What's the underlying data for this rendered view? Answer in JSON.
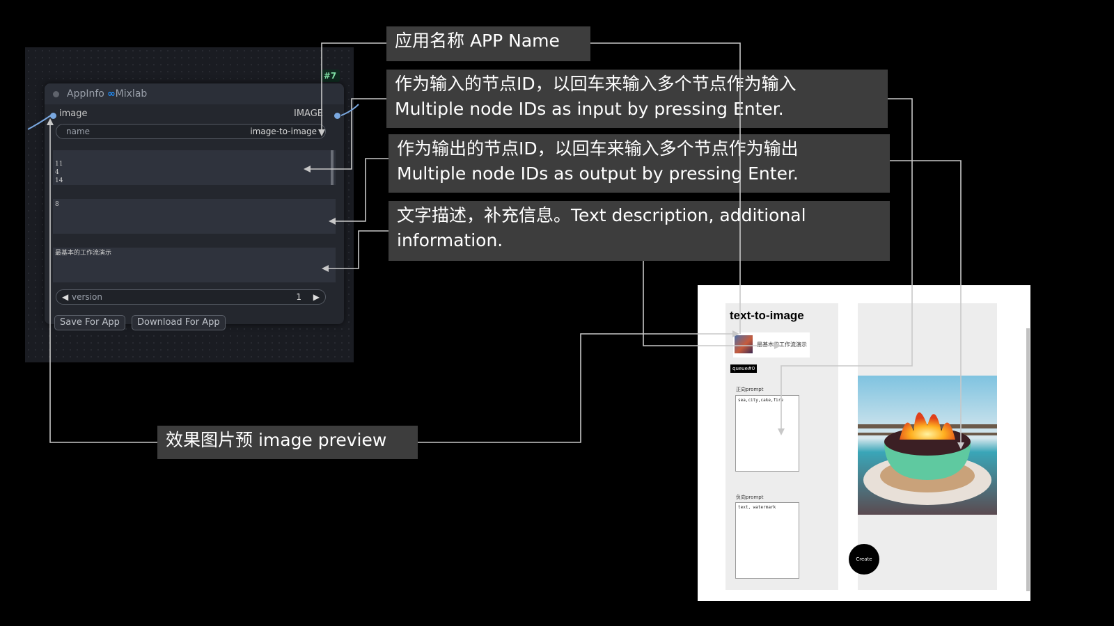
{
  "node": {
    "id_badge": "#7",
    "title": "AppInfo",
    "brand_icon": "∞",
    "brand": "Mixlab",
    "input_label": "image",
    "output_label": "IMAGE",
    "name_key": "name",
    "name_value": "image-to-image",
    "input_ids": "11\n4\n14",
    "output_ids": "8",
    "description": "最基本的工作流演示",
    "version_label": "version",
    "version_value": "1",
    "save_button": "Save For App",
    "download_button": "Download For App"
  },
  "callouts": {
    "app_name": "应用名称 APP Name",
    "input_zh": "作为输入的节点ID，以回车来输入多个节点作为输入",
    "input_en": "Multiple node IDs as input by pressing Enter.",
    "output_zh": "作为输出的节点ID，以回车来输入多个节点作为输出",
    "output_en": "Multiple node IDs as output by pressing Enter.",
    "description": "文字描述，补充信息。Text description, additional information.",
    "preview": "效果图片预 image preview"
  },
  "app": {
    "title": "text-to-image",
    "thumb_label": "最基本的工作流演示",
    "queue": "queue#0",
    "positive_label": "正向prompt",
    "positive_value": "sea,city,cake,fire",
    "negative_label": "负向prompt",
    "negative_value": "text, watermark",
    "create_button": "Create"
  },
  "colors": {
    "callout_bg": "#3d3d3d",
    "connector": "#c8c8c8",
    "slot_blue": "#7aa8e0",
    "mixlab_blue": "#1e8fff"
  }
}
